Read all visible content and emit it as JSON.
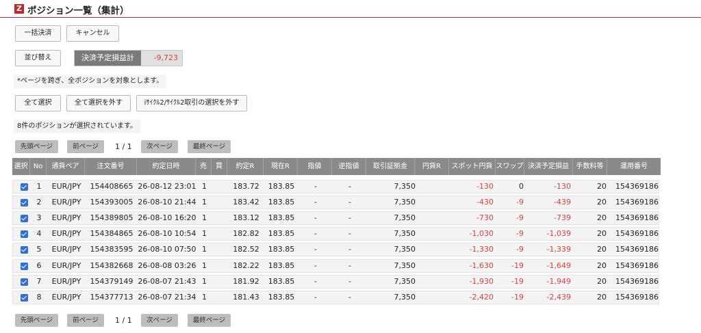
{
  "header": {
    "logo": "Z",
    "title": "ポジション一覧（集計）"
  },
  "actions": {
    "bulk_settle": "一括決済",
    "cancel": "キャンセル",
    "sort": "並び替え",
    "planned_pl_label": "決済予定損益計",
    "planned_pl_value": "-9,723"
  },
  "notes": {
    "cross_page": "*ページを跨ぎ、全ポジションを対象とします。",
    "selected_count": "8件のポジションが選択されています。"
  },
  "selection": {
    "select_all": "全て選択",
    "deselect_all": "全て選択を外す",
    "deselect_icycle": "iｻｲｸﾙ2/ｻｲｸﾙ2取引の選択を外す"
  },
  "pager": {
    "first": "先頭ページ",
    "prev": "前ページ",
    "info": "1 / 1",
    "next": "次ページ",
    "last": "最終ページ"
  },
  "table": {
    "headers": [
      "選択",
      "No",
      "通貨ペア",
      "注文番号",
      "約定日時",
      "売",
      "買",
      "約定R",
      "現在R",
      "指値",
      "逆指値",
      "取引証拠金",
      "円貨R",
      "スポット円貨",
      "スワップ",
      "決済予定損益",
      "手数料等",
      "運用番号"
    ],
    "rows": [
      [
        "1",
        "EUR/JPY",
        "154408665",
        "26-08-12 23:01",
        "1",
        "",
        "183.72",
        "183.85",
        "-",
        "-",
        "7,350",
        "",
        "-130",
        "0",
        "-130",
        "20",
        "154369186"
      ],
      [
        "2",
        "EUR/JPY",
        "154393005",
        "26-08-10 21:44",
        "1",
        "",
        "183.42",
        "183.85",
        "-",
        "-",
        "7,350",
        "",
        "-430",
        "-9",
        "-439",
        "20",
        "154369186"
      ],
      [
        "3",
        "EUR/JPY",
        "154389805",
        "26-08-10 16:20",
        "1",
        "",
        "183.12",
        "183.85",
        "-",
        "-",
        "7,350",
        "",
        "-730",
        "-9",
        "-739",
        "20",
        "154369186"
      ],
      [
        "4",
        "EUR/JPY",
        "154384865",
        "26-08-10 10:54",
        "1",
        "",
        "182.82",
        "183.85",
        "-",
        "-",
        "7,350",
        "",
        "-1,030",
        "-9",
        "-1,039",
        "20",
        "154369186"
      ],
      [
        "5",
        "EUR/JPY",
        "154383595",
        "26-08-10 07:50",
        "1",
        "",
        "182.52",
        "183.85",
        "-",
        "-",
        "7,350",
        "",
        "-1,330",
        "-9",
        "-1,339",
        "20",
        "154369186"
      ],
      [
        "6",
        "EUR/JPY",
        "154382668",
        "26-08-08 03:26",
        "1",
        "",
        "182.22",
        "183.85",
        "-",
        "-",
        "7,350",
        "",
        "-1,630",
        "-19",
        "-1,649",
        "20",
        "154369186"
      ],
      [
        "7",
        "EUR/JPY",
        "154379149",
        "26-08-07 21:43",
        "1",
        "",
        "181.92",
        "183.85",
        "-",
        "-",
        "7,350",
        "",
        "-1,930",
        "-19",
        "-1,949",
        "20",
        "154369186"
      ],
      [
        "8",
        "EUR/JPY",
        "154377713",
        "26-08-07 21:34",
        "1",
        "",
        "181.43",
        "183.85",
        "-",
        "-",
        "7,350",
        "",
        "-2,420",
        "-19",
        "-2,439",
        "20",
        "154369186"
      ]
    ]
  },
  "colors": {
    "accent": "#c0272d",
    "negative": "#e0403e",
    "header_bg": "#8a8a8a"
  }
}
